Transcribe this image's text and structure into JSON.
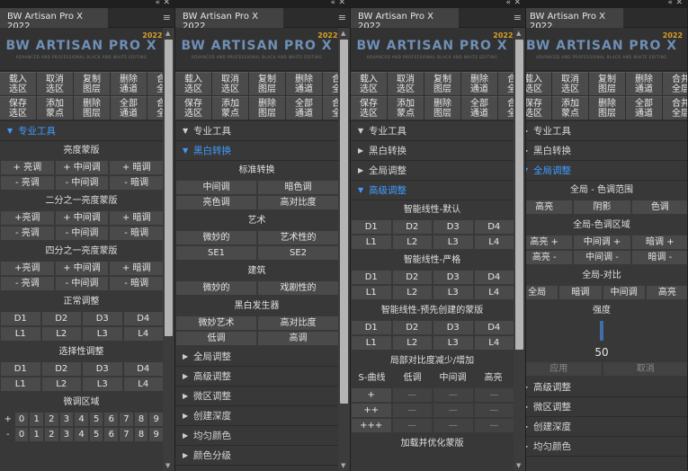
{
  "panel_title": "BW Artisan Pro X 2022",
  "logo": {
    "text": "BW ARTISAN PRO X",
    "year": "2022",
    "tagline": "ADVANCED AND PROFESSIONAL BLACK AND WHITE EDITING"
  },
  "toolbar": [
    {
      "label": "载入\n选区"
    },
    {
      "label": "取消\n选区"
    },
    {
      "label": "复制\n图层"
    },
    {
      "label": "删除\n通道"
    },
    {
      "label": "合并\n全层"
    },
    {
      "label": "保存\n选区"
    },
    {
      "label": "添加\n蒙点"
    },
    {
      "label": "删除\n图层"
    },
    {
      "label": "全部\n通道"
    },
    {
      "label": "合并\n全层"
    }
  ],
  "sections": {
    "pro_tools": "专业工具",
    "bw_convert": "黑白转换",
    "global_adjust": "全局调整",
    "advanced_adjust": "高级调整",
    "micro_adjust": "微区调整",
    "create_depth": "创建深度",
    "even_color": "均匀颜色",
    "color_grading": "颜色分级"
  },
  "p1": {
    "luminosity_mask": "亮度蒙版",
    "half_mask": "二分之一亮度蒙版",
    "quarter_mask": "四分之一亮度蒙版",
    "normal_adjust": "正常调整",
    "selective_adjust": "选择性调整",
    "micro_zone": "微调区域",
    "row_plus": [
      "+ 亮调",
      "+ 中间调",
      "+ 暗调"
    ],
    "row_minus": [
      "- 亮调",
      "- 中间调",
      "- 暗调"
    ],
    "row_plus2": [
      "+亮调",
      "+ 中间调",
      "+ 暗调"
    ],
    "row_minus2": [
      "- 亮调",
      "- 中间调",
      "- 暗调"
    ],
    "row_plus3": [
      "+亮调",
      "+ 中间调",
      "+ 暗调"
    ],
    "row_minus3": [
      "- 亮调",
      "- 中间调",
      "- 暗调"
    ],
    "d_row": [
      "D1",
      "D2",
      "D3",
      "D4"
    ],
    "l_row": [
      "L1",
      "L2",
      "L3",
      "L4"
    ],
    "plus": "+",
    "minus": "-",
    "digits": [
      "0",
      "1",
      "2",
      "3",
      "4",
      "5",
      "6",
      "7",
      "8",
      "9"
    ]
  },
  "p2": {
    "standard": "标准转换",
    "std_row1": [
      "中间调",
      "暗色调"
    ],
    "std_row2": [
      "亮色调",
      "高对比度"
    ],
    "art": "艺术",
    "art_row1": [
      "微妙的",
      "艺术性的"
    ],
    "art_row2": [
      "SE1",
      "SE2"
    ],
    "arch": "建筑",
    "arch_row1": [
      "微妙的",
      "戏剧性的"
    ],
    "generator": "黑白发生器",
    "gen_row1": [
      "微妙艺术",
      "高对比度"
    ],
    "gen_row2": [
      "低调",
      "高调"
    ]
  },
  "p3": {
    "smart_default": "智能线性-默认",
    "smart_strict": "智能线性-严格",
    "smart_pre": "智能线性-预先创建的蒙版",
    "local_contrast": "局部对比度减少/增加",
    "table_head": [
      "S-曲线",
      "低调",
      "中间调",
      "高亮"
    ],
    "t_row1": [
      "+",
      "—",
      "—",
      "—"
    ],
    "t_row2": [
      "++",
      "—",
      "—",
      "—"
    ],
    "t_row3": [
      "+++",
      "—",
      "—",
      "—"
    ],
    "add_optimize": "加载并优化蒙版"
  },
  "p4": {
    "tone_range": "全局 - 色调范围",
    "tone_row": [
      "高亮",
      "阴影",
      "色调"
    ],
    "tone_domain": "全局-色调区域",
    "dom_plus": [
      "高亮 +",
      "中间调 +",
      "暗调 +"
    ],
    "dom_minus": [
      "高亮 -",
      "中间调 -",
      "暗调 -"
    ],
    "contrast": "全局-对比",
    "contrast_row": [
      "全局",
      "暗调",
      "中间调",
      "高亮"
    ],
    "strength": "强度",
    "strength_value": "50",
    "strength_level": 0.5,
    "apply": "应用",
    "cancel": "取消"
  }
}
